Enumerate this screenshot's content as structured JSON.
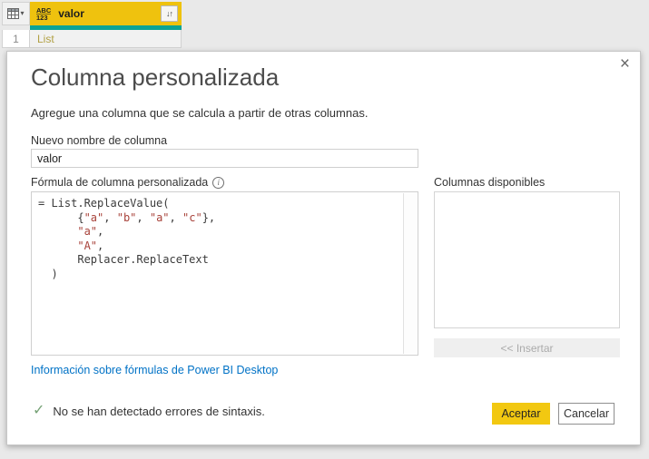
{
  "colors": {
    "accent": "#f2c811",
    "link": "#0072c6",
    "string-token": "#a8423a",
    "check": "#76a276",
    "header-bg": "#efc20e",
    "quality-bar": "#0ba394",
    "list-link": "#b1a044"
  },
  "table": {
    "corner_caret": "▾",
    "type_icon_top": "ABC",
    "type_icon_bottom": "123",
    "column_name": "valor",
    "expand_icon_glyph": "↓↑",
    "row": {
      "index": "1",
      "value": "List"
    }
  },
  "dialog": {
    "close_glyph": "×",
    "title": "Columna personalizada",
    "description": "Agregue una columna que se calcula a partir de otras columnas.",
    "name_label": "Nuevo nombre de columna",
    "name_value": "valor",
    "formula_label": "Fórmula de columna personalizada",
    "info_glyph": "i",
    "formula_lines": [
      [
        {
          "t": "= List.ReplaceValue(",
          "c": "plain"
        }
      ],
      [
        {
          "t": "      {",
          "c": "plain"
        },
        {
          "t": "\"a\"",
          "c": "string"
        },
        {
          "t": ", ",
          "c": "plain"
        },
        {
          "t": "\"b\"",
          "c": "string"
        },
        {
          "t": ", ",
          "c": "plain"
        },
        {
          "t": "\"a\"",
          "c": "string"
        },
        {
          "t": ", ",
          "c": "plain"
        },
        {
          "t": "\"c\"",
          "c": "string"
        },
        {
          "t": "},",
          "c": "plain"
        }
      ],
      [
        {
          "t": "      ",
          "c": "plain"
        },
        {
          "t": "\"a\"",
          "c": "string"
        },
        {
          "t": ",",
          "c": "plain"
        }
      ],
      [
        {
          "t": "      ",
          "c": "plain"
        },
        {
          "t": "\"A\"",
          "c": "string"
        },
        {
          "t": ",",
          "c": "plain"
        }
      ],
      [
        {
          "t": "      Replacer.ReplaceText",
          "c": "plain"
        }
      ],
      [
        {
          "t": "  )",
          "c": "plain"
        }
      ]
    ],
    "columns_label": "Columnas disponibles",
    "insert_button": "<< Insertar",
    "formula_link": "Información sobre fórmulas de Power BI Desktop",
    "check_glyph": "✓",
    "status_text": "No se han detectado errores de sintaxis.",
    "accept_button": "Aceptar",
    "cancel_button": "Cancelar"
  }
}
